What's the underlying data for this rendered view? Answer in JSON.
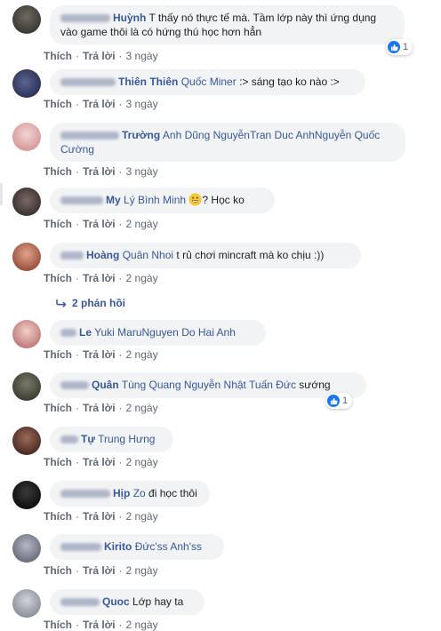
{
  "labels": {
    "like": "Thích",
    "reply": "Trả lời",
    "sep": "·",
    "like_count": "1",
    "replies": "2 phản hồi"
  },
  "comments": [
    {
      "name": "Huỳnh",
      "tags": "",
      "text1": "T thấy nó thực tế mà. Tầm lớp này thì ứng dụng",
      "text2": "vào game thôi là có hứng thú học hơn hẳn",
      "time": "3 ngày"
    },
    {
      "name": "Thiên Thiên",
      "tags": "Quốc Miner",
      "text1": ":> sáng tạo ko nào :>",
      "time": "3 ngày"
    },
    {
      "name": "Trường",
      "tags": "Anh Dũng NguyễnTran Duc AnhNguyễn Quốc",
      "tags2": "Cường",
      "time": "3 ngày"
    },
    {
      "name": "My",
      "tags": "Lý Bình Minh",
      "text1": "? Học ko",
      "time": "2 ngày"
    },
    {
      "name": "Hoàng",
      "tags": "Quân Nhoi",
      "text1": "t rủ chơi mincraft mà ko chịu :))",
      "time": "2 ngày"
    },
    {
      "name": "Le",
      "tags": "Yuki MaruNguyen Do Hai Anh",
      "time": "2 ngày"
    },
    {
      "name": "Quân",
      "tags": "Tùng Quang Nguyễn Nhật Tuấn Đức",
      "text1": "sướng",
      "time": "2 ngày"
    },
    {
      "name": "Tự",
      "tags": "Trung Hưng",
      "time": "2 ngày"
    },
    {
      "name": "Hịp",
      "tags": "Zo",
      "text1": "đi học thôi",
      "time": "2 ngày"
    },
    {
      "name": "Kirito",
      "tags": "Đức'ss Anh'ss",
      "time": "2 ngày"
    },
    {
      "name": "Quoc",
      "tags": "",
      "text1": "Lớp hay ta",
      "time": "2 ngày"
    }
  ],
  "colors": {
    "link": "#385898",
    "bubble": "#f2f3f5",
    "meta": "#606770",
    "like_blue": "#1877f2"
  }
}
